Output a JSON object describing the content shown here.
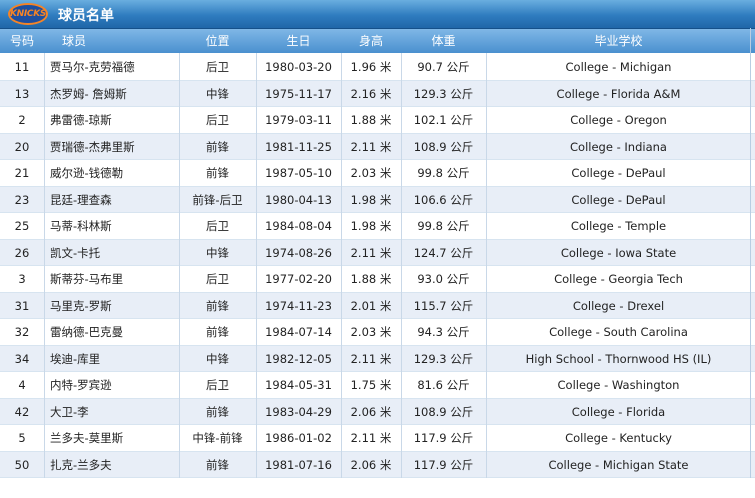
{
  "header": {
    "logo_text": "KNICKS",
    "title": "球员名单"
  },
  "columns": {
    "num": "号码",
    "name": "球员",
    "pos": "位置",
    "bday": "生日",
    "height": "身高",
    "weight": "体重",
    "school": "毕业学校"
  },
  "rows": [
    {
      "num": "11",
      "name": "贾马尔-克劳福德",
      "pos": "后卫",
      "bday": "1980-03-20",
      "height": "1.96 米",
      "weight": "90.7 公斤",
      "school": "College - Michigan"
    },
    {
      "num": "13",
      "name": "杰罗姆- 詹姆斯",
      "pos": "中锋",
      "bday": "1975-11-17",
      "height": "2.16 米",
      "weight": "129.3 公斤",
      "school": "College - Florida A&M"
    },
    {
      "num": "2",
      "name": "弗雷德-琼斯",
      "pos": "后卫",
      "bday": "1979-03-11",
      "height": "1.88 米",
      "weight": "102.1 公斤",
      "school": "College - Oregon"
    },
    {
      "num": "20",
      "name": "贾瑞德-杰弗里斯",
      "pos": "前锋",
      "bday": "1981-11-25",
      "height": "2.11 米",
      "weight": "108.9 公斤",
      "school": "College - Indiana"
    },
    {
      "num": "21",
      "name": "威尔逊-钱德勒",
      "pos": "前锋",
      "bday": "1987-05-10",
      "height": "2.03 米",
      "weight": "99.8 公斤",
      "school": "College - DePaul"
    },
    {
      "num": "23",
      "name": "昆廷-理查森",
      "pos": "前锋-后卫",
      "bday": "1980-04-13",
      "height": "1.98 米",
      "weight": "106.6 公斤",
      "school": "College - DePaul"
    },
    {
      "num": "25",
      "name": "马蒂-科林斯",
      "pos": "后卫",
      "bday": "1984-08-04",
      "height": "1.98 米",
      "weight": "99.8 公斤",
      "school": "College - Temple"
    },
    {
      "num": "26",
      "name": "凯文-卡托",
      "pos": "中锋",
      "bday": "1974-08-26",
      "height": "2.11 米",
      "weight": "124.7 公斤",
      "school": "College - Iowa State"
    },
    {
      "num": "3",
      "name": "斯蒂芬-马布里",
      "pos": "后卫",
      "bday": "1977-02-20",
      "height": "1.88 米",
      "weight": "93.0 公斤",
      "school": "College - Georgia Tech"
    },
    {
      "num": "31",
      "name": "马里克-罗斯",
      "pos": "前锋",
      "bday": "1974-11-23",
      "height": "2.01 米",
      "weight": "115.7 公斤",
      "school": "College - Drexel"
    },
    {
      "num": "32",
      "name": "雷纳德-巴克曼",
      "pos": "前锋",
      "bday": "1984-07-14",
      "height": "2.03 米",
      "weight": "94.3 公斤",
      "school": "College - South Carolina"
    },
    {
      "num": "34",
      "name": "埃迪-库里",
      "pos": "中锋",
      "bday": "1982-12-05",
      "height": "2.11 米",
      "weight": "129.3 公斤",
      "school": "High School - Thornwood HS (IL)"
    },
    {
      "num": "4",
      "name": "内特-罗宾逊",
      "pos": "后卫",
      "bday": "1984-05-31",
      "height": "1.75 米",
      "weight": "81.6 公斤",
      "school": "College - Washington"
    },
    {
      "num": "42",
      "name": "大卫-李",
      "pos": "前锋",
      "bday": "1983-04-29",
      "height": "2.06 米",
      "weight": "108.9 公斤",
      "school": "College - Florida"
    },
    {
      "num": "5",
      "name": "兰多夫-莫里斯",
      "pos": "中锋-前锋",
      "bday": "1986-01-02",
      "height": "2.11 米",
      "weight": "117.9 公斤",
      "school": "College - Kentucky"
    },
    {
      "num": "50",
      "name": "扎克-兰多夫",
      "pos": "前锋",
      "bday": "1981-07-16",
      "height": "2.06 米",
      "weight": "117.9 公斤",
      "school": "College - Michigan State"
    }
  ]
}
